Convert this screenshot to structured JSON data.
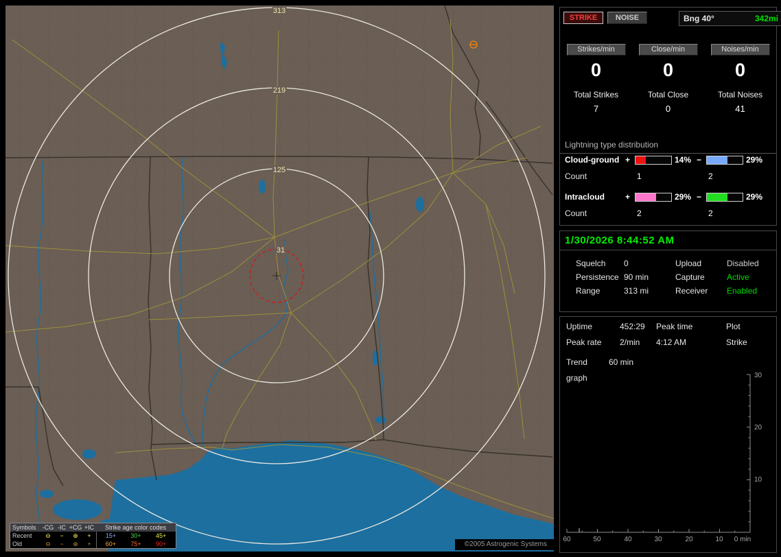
{
  "map": {
    "ring_labels": [
      "313",
      "219",
      "125",
      "31"
    ],
    "copyright": "©2005 Astrogenic Systems",
    "legend": {
      "symbols_header": "Symbols",
      "type_headers": [
        "-CG",
        "-IC",
        "+CG",
        "+IC"
      ],
      "age_header": "Strike age color codes",
      "symbol_glyphs": [
        "⊖",
        "−",
        "⊕",
        "+"
      ],
      "rows": [
        {
          "label": "Recent",
          "ages": [
            {
              "text": "15+",
              "color": "#8caaff"
            },
            {
              "text": "30+",
              "color": "#4cd94c"
            },
            {
              "text": "45+",
              "color": "#e8e84c"
            }
          ]
        },
        {
          "label": "Old",
          "ages": [
            {
              "text": "60+",
              "color": "#ffaa33"
            },
            {
              "text": "75+",
              "color": "#ff6633"
            },
            {
              "text": "90+",
              "color": "#ff2222"
            }
          ]
        }
      ]
    }
  },
  "sidebar": {
    "mode_buttons": {
      "strike": "STRIKE",
      "noise": "NOISE"
    },
    "bearing": {
      "label": "Bng 40°",
      "value": "342mi",
      "value_color": "#00e000"
    },
    "rates": [
      {
        "label": "Strikes/min",
        "value": "0"
      },
      {
        "label": "Close/min",
        "value": "0"
      },
      {
        "label": "Noises/min",
        "value": "0"
      }
    ],
    "totals": [
      {
        "label": "Total Strikes",
        "value": "7"
      },
      {
        "label": "Total Close",
        "value": "0"
      },
      {
        "label": "Total Noises",
        "value": "41"
      }
    ],
    "distribution": {
      "title": "Lightning type distribution",
      "rows": [
        {
          "label": "Cloud-ground",
          "plus_sign": "+",
          "plus_pct": "14%",
          "plus_color": "#ee1111",
          "minus_sign": "−",
          "minus_pct": "29%",
          "minus_color": "#77aaff",
          "count_label": "Count",
          "plus_count": "1",
          "minus_count": "2"
        },
        {
          "label": "Intracloud",
          "plus_sign": "+",
          "plus_pct": "29%",
          "plus_color": "#ff77cc",
          "minus_sign": "−",
          "minus_pct": "29%",
          "minus_color": "#22dd22",
          "count_label": "Count",
          "plus_count": "2",
          "minus_count": "2"
        }
      ]
    },
    "clock": "1/30/2026 8:44:52 AM",
    "status_rows": [
      {
        "k1": "Squelch",
        "v1": "0",
        "k2": "Upload",
        "v2": "Disabled",
        "v2_color": "#cfcfcf"
      },
      {
        "k1": "Persistence",
        "v1": "90 min",
        "k2": "Capture",
        "v2": "Active",
        "v2_color": "#00dd00"
      },
      {
        "k1": "Range",
        "v1": "313 mi",
        "k2": "Receiver",
        "v2": "Enabled",
        "v2_color": "#00dd00"
      }
    ],
    "session": {
      "r1": [
        "Uptime",
        "452:29",
        "Peak time",
        "Plot"
      ],
      "r2": [
        "Peak rate",
        "2/min",
        "4:12 AM",
        "Strike"
      ],
      "trend_label": "Trend graph",
      "trend_value": "60 min"
    },
    "trend_chart": {
      "y_ticks": [
        "30",
        "20",
        "10"
      ],
      "x_ticks": [
        "60",
        "50",
        "40",
        "30",
        "20",
        "10"
      ],
      "x_end_label": "0 min"
    }
  }
}
